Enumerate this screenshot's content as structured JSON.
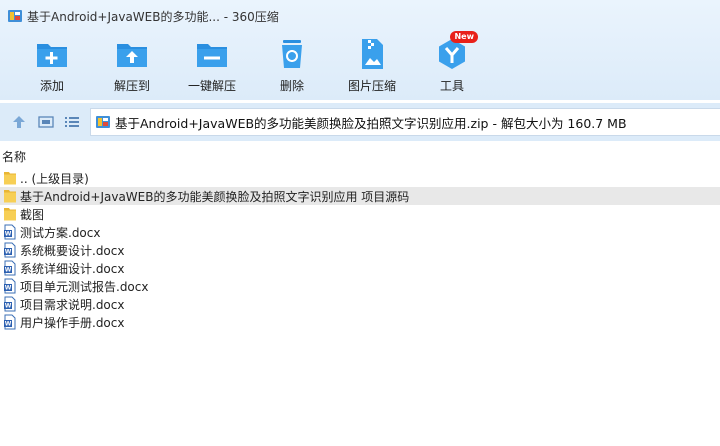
{
  "window": {
    "title": "基于Android+JavaWEB的多功能... - 360压缩"
  },
  "toolbar": {
    "buttons": [
      {
        "id": "add",
        "label": "添加",
        "icon": "add-folder-icon"
      },
      {
        "id": "extract-to",
        "label": "解压到",
        "icon": "extract-to-icon"
      },
      {
        "id": "one-click",
        "label": "一键解压",
        "icon": "one-click-extract-icon"
      },
      {
        "id": "delete",
        "label": "删除",
        "icon": "trash-icon"
      },
      {
        "id": "image-compress",
        "label": "图片压缩",
        "icon": "image-compress-icon"
      },
      {
        "id": "tools",
        "label": "工具",
        "icon": "tools-icon",
        "badge": "New"
      }
    ]
  },
  "address": {
    "path": "基于Android+JavaWEB的多功能美颜换脸及拍照文字识别应用.zip - 解包大小为 160.7 MB"
  },
  "columns": {
    "name": "名称"
  },
  "files": [
    {
      "name": ".. (上级目录)",
      "type": "folder"
    },
    {
      "name": "基于Android+JavaWEB的多功能美颜换脸及拍照文字识别应用 项目源码",
      "type": "folder",
      "selected": true
    },
    {
      "name": "截图",
      "type": "folder"
    },
    {
      "name": "测试方案.docx",
      "type": "docx"
    },
    {
      "name": "系统概要设计.docx",
      "type": "docx"
    },
    {
      "name": "系统详细设计.docx",
      "type": "docx"
    },
    {
      "name": "项目单元测试报告.docx",
      "type": "docx"
    },
    {
      "name": "项目需求说明.docx",
      "type": "docx"
    },
    {
      "name": "用户操作手册.docx",
      "type": "docx"
    }
  ],
  "colors": {
    "accent": "#2a8fe0",
    "badge": "#e8211a",
    "folder": "#f5c842"
  }
}
